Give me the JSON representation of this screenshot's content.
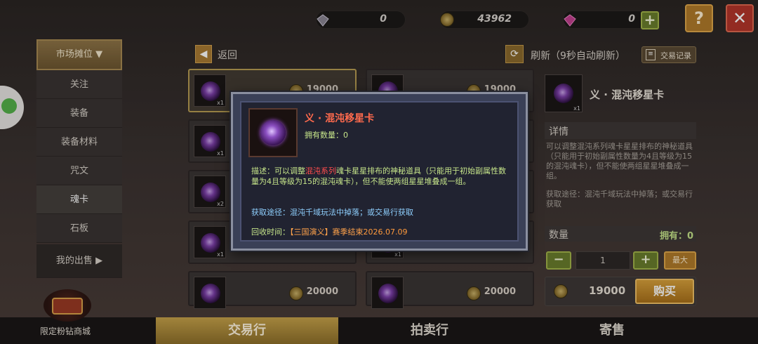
{
  "topbar": {
    "diamond_value": "0",
    "gold_value": "43962",
    "gem_value": "0",
    "help_label": "?",
    "close_label": "✕"
  },
  "sidebar": {
    "header": "市场摊位",
    "items": [
      "关注",
      "装备",
      "装备材料",
      "咒文",
      "魂卡",
      "石板"
    ],
    "my_sales": "我的出售"
  },
  "header": {
    "back": "返回",
    "refresh": "刷新（9秒自动刷新）",
    "records": "交易记录"
  },
  "grid": {
    "items": [
      {
        "count": "x1",
        "price": "19000"
      },
      {
        "count": "",
        "price": "19000"
      },
      {
        "count": "x1",
        "price": ""
      },
      {
        "count": "",
        "price": ""
      },
      {
        "count": "x2",
        "price": ""
      },
      {
        "count": "",
        "price": ""
      },
      {
        "count": "x1",
        "price": ""
      },
      {
        "count": "x1",
        "price": ""
      },
      {
        "count": "",
        "price": "20000"
      },
      {
        "count": "",
        "price": "20000"
      }
    ]
  },
  "detail": {
    "name": "义 · 混沌移星卡",
    "count": "x1",
    "section": "详情",
    "desc": "可以调整混沌系列魂卡星星排布的神秘道具（只能用于初始副属性数量为4且等级为15的混沌魂卡），但不能使两组星星堆叠成一组。",
    "source": "获取途径：混沌千域玩法中掉落；或交易行获取",
    "qty_label": "数量",
    "owned": "拥有：0",
    "qty_value": "1",
    "max_label": "最大",
    "price": "19000",
    "buy": "购买"
  },
  "modal": {
    "title": "义 · 混沌移星卡",
    "owned": "拥有数量：0",
    "desc_prefix": "描述：可以调整",
    "desc_highlight": "混沌系列",
    "desc_rest": "魂卡星星排布的神秘道具（只能用于初始副属性数量为4且等级为15的混沌魂卡），但不能使两组星星堆叠成一组。",
    "source": "获取途径：混沌千域玩法中掉落；或交易行获取",
    "recycle_prefix": "回收时间：",
    "recycle_event": "【三国演义】赛季结束",
    "recycle_date": "2026.07.09"
  },
  "bottom": {
    "shop": "限定粉钻商城",
    "tabs": [
      "交易行",
      "拍卖行",
      "寄售"
    ]
  },
  "colors": {
    "accent_gold": "#c8a34e",
    "title_red": "#ff6a4d",
    "highlight_red": "#ff4d4d",
    "text_green": "#c6e58a",
    "text_blue": "#8fd0ff",
    "date_orange": "#ff9a3c"
  }
}
